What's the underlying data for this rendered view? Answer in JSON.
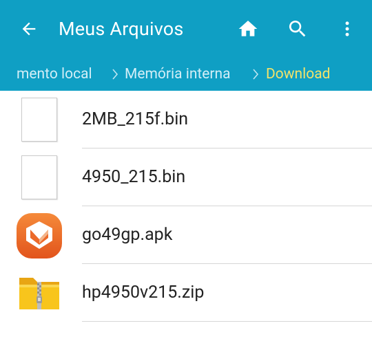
{
  "toolbar": {
    "title": "Meus Arquivos",
    "back_icon": "arrow-left-icon",
    "home_icon": "home-icon",
    "search_icon": "search-icon",
    "more_icon": "more-vert-icon"
  },
  "breadcrumbs": [
    {
      "label": "mento local"
    },
    {
      "label": "Memória interna"
    },
    {
      "label": "Download"
    }
  ],
  "files": [
    {
      "name": "2MB_215f.bin",
      "icon": "document-icon"
    },
    {
      "name": "4950_215.bin",
      "icon": "document-icon"
    },
    {
      "name": "go49gp.apk",
      "icon": "apk-app-icon"
    },
    {
      "name": "hp4950v215.zip",
      "icon": "zip-folder-icon"
    }
  ],
  "colors": {
    "appbar": "#0f9fc4",
    "breadcrumb_text": "#d2eef7",
    "breadcrumb_active": "#f2e36a"
  }
}
